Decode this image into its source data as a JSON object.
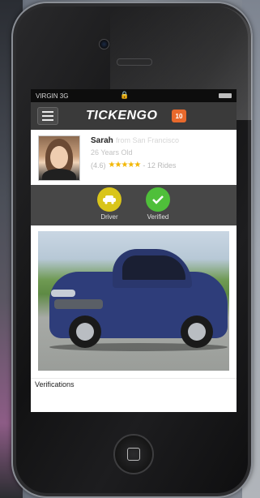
{
  "status": {
    "carrier": "VIRGIN 3G",
    "lock_glyph": "🔒"
  },
  "app": {
    "name": "TICKENGO",
    "badge": "10"
  },
  "profile": {
    "name": "Sarah",
    "from": "from San Francisco",
    "age": "26 Years Old",
    "rating_prefix": "(4.6)",
    "stars": "★★★★★",
    "rides": "- 12 Rides"
  },
  "badges": {
    "driver_label": "Driver",
    "verified_label": "Verified",
    "driver_icon": "car-icon",
    "verified_icon": "check-icon"
  },
  "section": {
    "title": "Verifications"
  },
  "colors": {
    "brand_orange": "#e8692c",
    "driver_yellow": "#d9c51a",
    "verified_green": "#4fbf3a",
    "appbar_dark": "#3a3a3a"
  }
}
